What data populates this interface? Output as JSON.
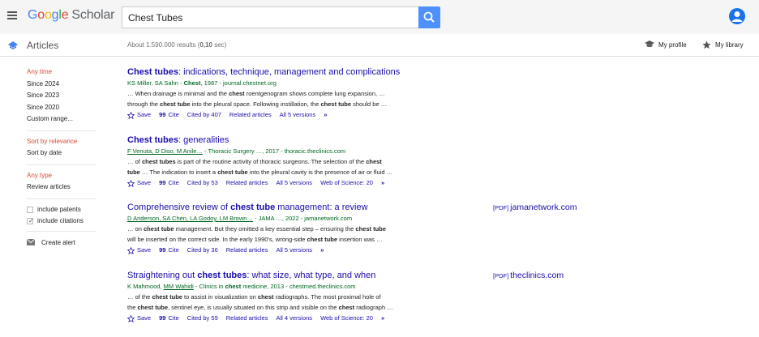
{
  "header": {
    "logo": {
      "g1": "G",
      "o1": "o",
      "o2": "o",
      "g2": "g",
      "l": "l",
      "e": "e",
      "scholar": "Scholar"
    },
    "search_value": "Chest Tubes",
    "colors": {
      "search_button": "#4d90fe",
      "avatar": "#1a73e8"
    }
  },
  "subheader": {
    "section_label": "Articles",
    "results_count": "About 1.590.000 results (0,10 sec)",
    "my_profile": "My profile",
    "my_library": "My library"
  },
  "sidebar": {
    "time": [
      {
        "label": "Any time",
        "selected": true
      },
      {
        "label": "Since 2024",
        "selected": false
      },
      {
        "label": "Since 2023",
        "selected": false
      },
      {
        "label": "Since 2020",
        "selected": false
      },
      {
        "label": "Custom range...",
        "selected": false
      }
    ],
    "sort": [
      {
        "label": "Sort by relevance",
        "selected": true
      },
      {
        "label": "Sort by date",
        "selected": false
      }
    ],
    "type": [
      {
        "label": "Any type",
        "selected": true
      },
      {
        "label": "Review articles",
        "selected": false
      }
    ],
    "include_patents": "include patents",
    "include_citations": "include citations",
    "create_alert": "Create alert"
  },
  "results": [
    {
      "title_bold": "Chest tubes",
      "title_rest": ": indications, technique, management and complications",
      "authors": "KS Miller, SA Sahn",
      "source_pre": " - ",
      "source_bold": "Chest",
      "source_rest": ", 1987 - journal.chestnet.org",
      "snippet1": "… When drainage is minimal and the chest roentgenogram shows complete lung expansion, …",
      "snippet2": "through the chest tube into the pleural space. Following instillation, the chest tube should be …",
      "cited_by": "Cited by 407",
      "related": "Related articles",
      "versions": "All 5 versions",
      "wos": ""
    },
    {
      "title_bold": "Chest tubes",
      "title_rest": ": generalities",
      "authors": "F Venuta, D Diso, M Anile…",
      "source_pre": " - Thoracic Surgery …, 2017 - thoracic.theclinics.com",
      "source_bold": "",
      "source_rest": "",
      "snippet1": "… of chest tubes is part of the routine activity of thoracic surgeons. The selection of the chest",
      "snippet2": "tube … The indication to insert a chest tube into the pleural cavity is the presence of air or fluid …",
      "cited_by": "Cited by 53",
      "related": "Related articles",
      "versions": "All 5 versions",
      "wos": "Web of Science: 20"
    },
    {
      "title_pre": "Comprehensive review of ",
      "title_bold": "chest tube",
      "title_rest": " management: a review",
      "authors": "D Anderson, SA Chen, LA Godoy, LM Brown…",
      "source_pre": " - JAMA …, 2022 - jamanetwork.com",
      "source_bold": "",
      "source_rest": "",
      "snippet1": "… on chest tube management. But they omitted a key essential step – ensuring the chest tube",
      "snippet2": "will be inserted on the correct side. In the early 1990's, wrong-side chest tube insertion was …",
      "cited_by": "Cited by 36",
      "related": "Related articles",
      "versions": "All 5 versions",
      "wos": "",
      "pdf_tag": "[PDF]",
      "pdf_host": "jamanetwork.com"
    },
    {
      "title_pre": "Straightening out ",
      "title_bold": "chest tubes",
      "title_rest": ": what size, what type, and when",
      "authors": "K Mahmood, MM Wahidi",
      "source_pre": " - Clinics in ",
      "source_bold": "chest",
      "source_rest": " medicine, 2013 - chestmed.theclinics.com",
      "snippet1": "… of the chest tube to assist in visualization on chest radiographs. The most proximal hole of",
      "snippet2": "the chest tube, sentinel eye, is usually situated on this strip and visible on the chest radiograph …",
      "cited_by": "Cited by 59",
      "related": "Related articles",
      "versions": "All 4 versions",
      "wos": "Web of Science: 20",
      "pdf_tag": "[PDF]",
      "pdf_host": "theclinics.com"
    }
  ],
  "actions": {
    "save": "Save",
    "cite": "Cite",
    "cite_glyph": "99",
    "more_glyph": "»"
  },
  "icons": [
    "menu-icon",
    "search-icon",
    "avatar-icon",
    "scholar-articles-icon",
    "graduation-cap-icon",
    "star-icon",
    "envelope-icon"
  ]
}
